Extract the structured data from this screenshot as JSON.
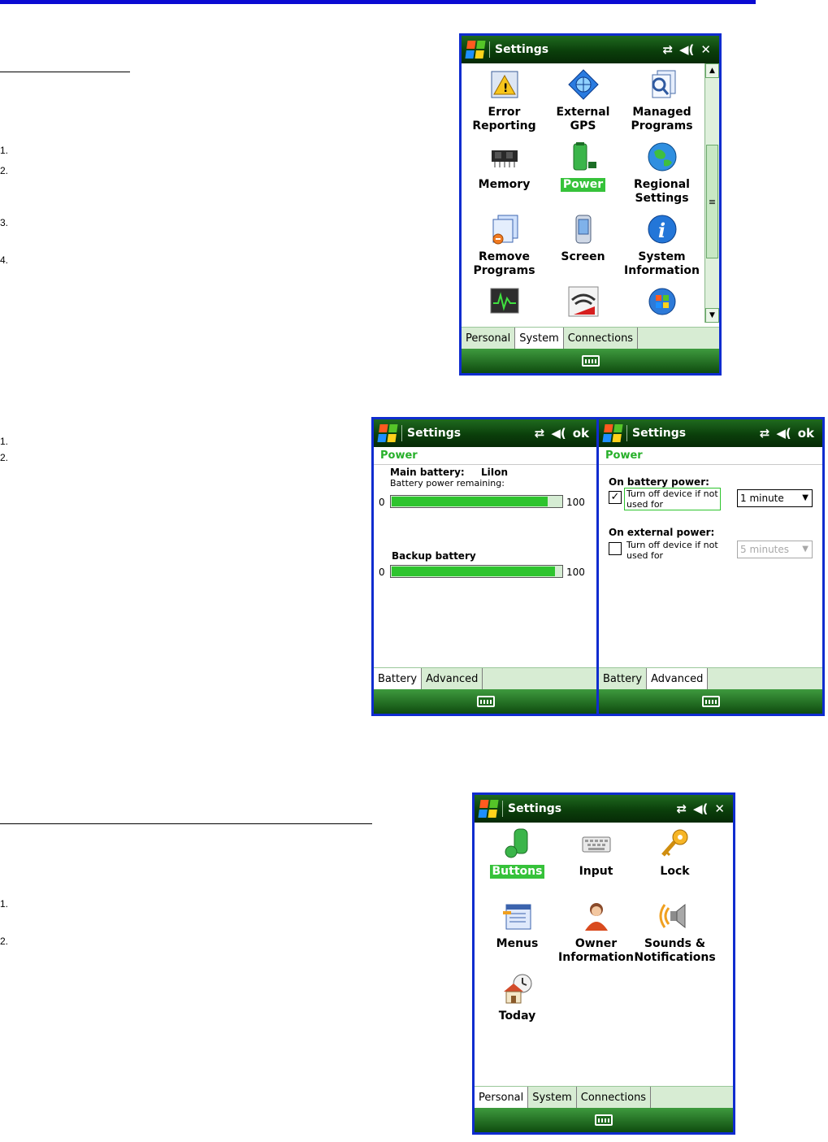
{
  "document": {
    "steps_first": [
      "1.",
      "2.",
      "3.",
      "4."
    ],
    "steps_second": [
      "1.",
      "2."
    ],
    "steps_third": [
      "1.",
      "2."
    ]
  },
  "system_screen": {
    "title": "Settings",
    "close_glyph": "✕",
    "items": [
      {
        "label_l1": "Error",
        "label_l2": "Reporting",
        "icon": "error-reporting-icon"
      },
      {
        "label_l1": "External",
        "label_l2": "GPS",
        "icon": "external-gps-icon"
      },
      {
        "label_l1": "Managed",
        "label_l2": "Programs",
        "icon": "managed-programs-icon"
      },
      {
        "label_l1": "Memory",
        "label_l2": "",
        "icon": "memory-icon"
      },
      {
        "label_l1": "Power",
        "label_l2": "",
        "icon": "power-icon",
        "selected": true
      },
      {
        "label_l1": "Regional",
        "label_l2": "Settings",
        "icon": "regional-settings-icon"
      },
      {
        "label_l1": "Remove",
        "label_l2": "Programs",
        "icon": "remove-programs-icon"
      },
      {
        "label_l1": "Screen",
        "label_l2": "",
        "icon": "screen-icon"
      },
      {
        "label_l1": "System",
        "label_l2": "Information",
        "icon": "system-information-icon"
      }
    ],
    "tabs": [
      "Personal",
      "System",
      "Connections"
    ],
    "active_tab": "System"
  },
  "power_battery": {
    "title": "Settings",
    "ok": "ok",
    "subtitle": "Power",
    "main_battery_label": "Main battery:",
    "main_battery_type": "LiIon",
    "remaining_label": "Battery power remaining:",
    "scale_min": "0",
    "scale_max": "100",
    "main_level_pct": 92,
    "backup_label": "Backup battery",
    "backup_level_pct": 96,
    "tabs": [
      "Battery",
      "Advanced"
    ],
    "active_tab": "Battery"
  },
  "power_advanced": {
    "title": "Settings",
    "ok": "ok",
    "subtitle": "Power",
    "battery_heading": "On battery power:",
    "battery_option_l1": "Turn off device if not",
    "battery_option_l2": "used for",
    "battery_checked": true,
    "battery_value": "1 minute",
    "external_heading": "On external power:",
    "external_option_l1": "Turn off device if not",
    "external_option_l2": "used for",
    "external_checked": false,
    "external_value": "5 minutes",
    "tabs": [
      "Battery",
      "Advanced"
    ],
    "active_tab": "Advanced"
  },
  "personal_screen": {
    "title": "Settings",
    "close_glyph": "✕",
    "items": [
      {
        "label_l1": "Buttons",
        "label_l2": "",
        "icon": "buttons-icon",
        "selected": true
      },
      {
        "label_l1": "Input",
        "label_l2": "",
        "icon": "input-keyboard-icon"
      },
      {
        "label_l1": "Lock",
        "label_l2": "",
        "icon": "lock-key-icon"
      },
      {
        "label_l1": "Menus",
        "label_l2": "",
        "icon": "menus-icon"
      },
      {
        "label_l1": "Owner",
        "label_l2": "Information",
        "icon": "owner-information-icon"
      },
      {
        "label_l1": "Sounds &",
        "label_l2": "Notifications",
        "icon": "sounds-notifications-icon"
      },
      {
        "label_l1": "Today",
        "label_l2": "",
        "icon": "today-icon"
      }
    ],
    "tabs": [
      "Personal",
      "System",
      "Connections"
    ],
    "active_tab": "Personal"
  },
  "colors": {
    "titlebar": "#0b3f0b",
    "accent_green": "#36c23a",
    "frame_blue": "#0f2ccf"
  }
}
